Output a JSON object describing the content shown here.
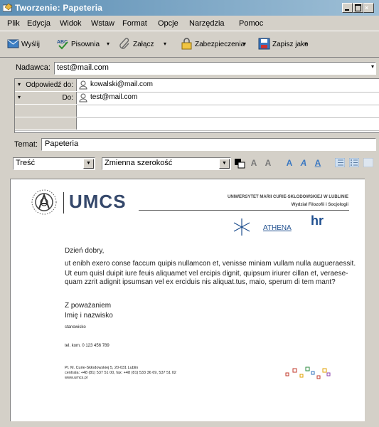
{
  "window": {
    "title": "Tworzenie: Papeteria"
  },
  "menu": [
    "Plik",
    "Edycja",
    "Widok",
    "Wstaw",
    "Format",
    "Opcje",
    "Narzędzia",
    "Pomoc"
  ],
  "toolbar": {
    "send": "Wyślij",
    "spelling": "Pisownia",
    "attach": "Załącz",
    "security": "Zabezpieczenia",
    "save_as": "Zapisz jako"
  },
  "sender": {
    "label": "Nadawca:",
    "value": "test@mail.com"
  },
  "recipients": [
    {
      "type": "Odpowiedź do:",
      "address": "kowalski@mail.com"
    },
    {
      "type": "Do:",
      "address": "test@mail.com"
    }
  ],
  "subject": {
    "label": "Temat:",
    "value": "Papeteria"
  },
  "format": {
    "paragraph_style": "Treść",
    "font": "Zmienna szerokość"
  },
  "letter": {
    "logo_text": "UMCS",
    "university": "UNIWERSYTET MARII CURIE-SKŁODOWSKIEJ W LUBLINIE",
    "faculty": "Wydział Filozofii i Socjologii",
    "athena": "ATHENA",
    "hr_logo": "hr",
    "greeting": "Dzień dobry,",
    "para1": "ut enibh exero conse faccum quipis nullamcon et, venisse miniam vullam nulla augueraessit.",
    "para2a": "Ut eum quisl duipit iure feuis aliquamet vel ercipis dignit, quipsum iriurer cillan et, veraese-",
    "para2b": "quam zzrit adignit ipsumsan vel ex erciduis nis aliquat.tus, maio, sperum di tem mant?",
    "regards": "Z poważaniem",
    "name": "Imię i nazwisko",
    "position": "stanowisko",
    "phone": "tel. kom. 0 123 456 789",
    "addr1": "Pl. M. Curie-Skłodowskiej 5, 20-031 Lublin",
    "addr2": "centrala: +48 (81) 537 51 00, fax: +48 (81) 533 36 69, 537 51 02",
    "addr3": "www.umcs.pl"
  },
  "colors": {
    "title_gradient_start": "#5d8fb5",
    "accent_blue": "#1f4f8f",
    "text": "#222222"
  }
}
